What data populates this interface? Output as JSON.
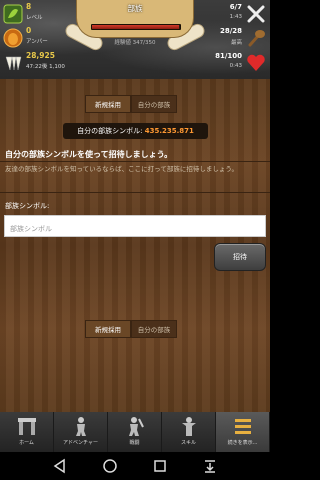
{
  "hud": {
    "level": {
      "value": "8",
      "label": "レベル"
    },
    "amber": {
      "value": "0",
      "label": "アンバー"
    },
    "food": {
      "value": "28,925",
      "label": "47:22後 1,100"
    },
    "banner_title": "部族",
    "xp": {
      "label": "経験値 347/350",
      "fraction": 0.99
    },
    "right": [
      {
        "value": "6/7",
        "label": "1:43",
        "icon": "crossed-bones-icon"
      },
      {
        "value": "28/28",
        "label": "最高",
        "icon": "club-icon"
      },
      {
        "value": "81/100",
        "label": "0:43",
        "icon": "heart-icon"
      }
    ]
  },
  "tabs": [
    "新規採用",
    "自分の部族"
  ],
  "symbol": {
    "label": "自分の部族シンボル:",
    "number": "435.235.871"
  },
  "invite": {
    "title": "自分の部族シンボルを使って招待しましょう。",
    "description": "友達の部族シンボルを知っているならば、ここに打って部族に招待しましょう。"
  },
  "field": {
    "label": "部族シンボル:",
    "placeholder": "部族シンボル"
  },
  "invite_button": "招待",
  "nav": [
    {
      "label": "ホーム",
      "icon": "stonehenge-icon"
    },
    {
      "label": "アドベンチャー",
      "icon": "adventurer-icon"
    },
    {
      "label": "戦闘",
      "icon": "fighter-icon"
    },
    {
      "label": "スキル",
      "icon": "skill-figure-icon"
    },
    {
      "label": "続きを表示...",
      "icon": "more-menu-icon"
    }
  ],
  "colors": {
    "accent": "#ff9933",
    "gold": "#e8c84a",
    "wood": "#5b3a1d"
  }
}
